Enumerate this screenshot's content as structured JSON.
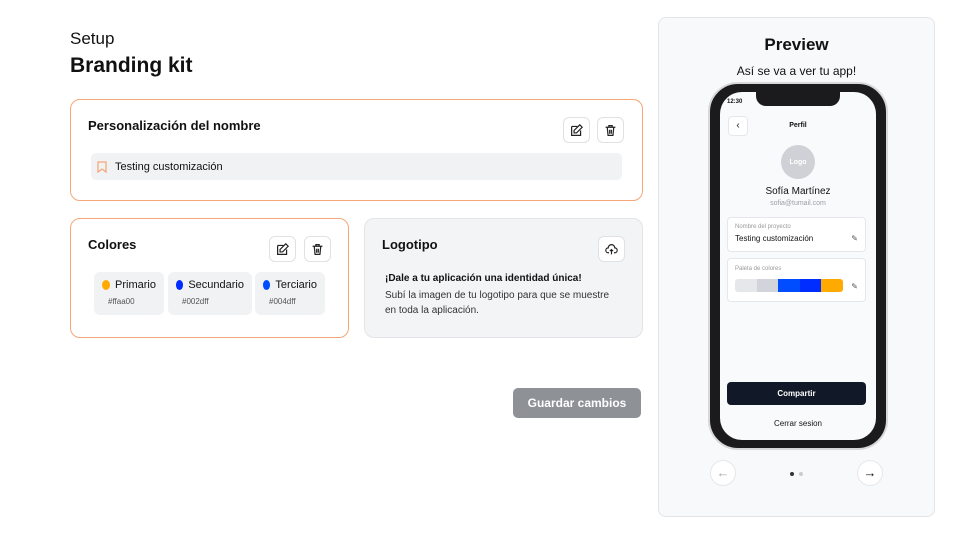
{
  "header": {
    "subtitle": "Setup",
    "title": "Branding kit"
  },
  "name_card": {
    "title": "Personalización del nombre",
    "value": "Testing customización"
  },
  "colors_card": {
    "title": "Colores",
    "colors": [
      {
        "label": "Primario",
        "hex": "#ffaa00"
      },
      {
        "label": "Secundario",
        "hex": "#002dff"
      },
      {
        "label": "Terciario",
        "hex": "#004dff"
      }
    ]
  },
  "logo_card": {
    "title": "Logotipo",
    "headline": "¡Dale a tu aplicación una identidad única!",
    "body": "Subí la imagen de tu logotipo para que se muestre en toda la aplicación."
  },
  "save_label": "Guardar cambios",
  "preview": {
    "title": "Preview",
    "subtitle": "Así se va a ver tu app!",
    "phone": {
      "time": "12:30",
      "screen_title": "Perfil",
      "logo": "Logo",
      "user_name": "Sofía Martínez",
      "email": "sofia@tumail.com",
      "project_label": "Nombre del proyecto",
      "project_value": "Testing customización",
      "palette_label": "Paleta de colores",
      "palette": [
        "#e5e7eb",
        "#d1d5db",
        "#004dff",
        "#002dff",
        "#ffaa00"
      ],
      "share_label": "Compartir",
      "logout_label": "Cerrar sesion"
    },
    "page": 1,
    "pages": 2
  }
}
